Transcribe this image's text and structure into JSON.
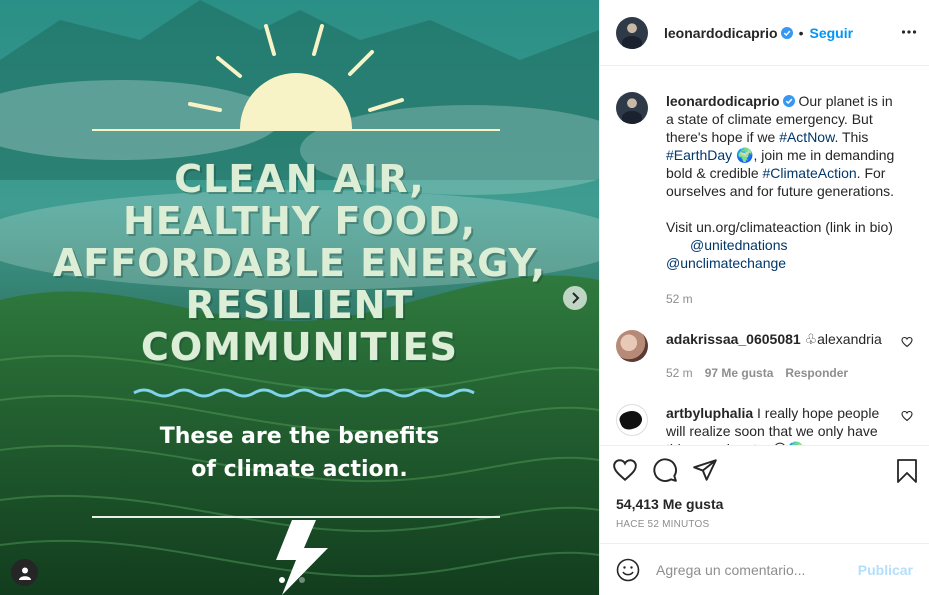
{
  "post": {
    "image": {
      "headline_lines": [
        "CLEAN AIR,",
        "HEALTHY FOOD,",
        "AFFORDABLE ENERGY,",
        "RESILIENT",
        "COMMUNITIES"
      ],
      "sub_lines": [
        "These are the benefits",
        "of climate action."
      ],
      "carousel_total": 3,
      "carousel_active": 1
    },
    "header": {
      "username": "leonardodicaprio",
      "separator": "•",
      "follow_label": "Seguir"
    },
    "caption": {
      "username": "leonardodicaprio",
      "text_1": " Our planet is in a state of climate emergency. But there's hope if we ",
      "tag_actnow": "#ActNow",
      "text_2": ". This ",
      "tag_earthday": "#EarthDay",
      "text_3": " 🌍, join me in demanding bold & credible ",
      "tag_climateaction": "#ClimateAction",
      "text_4": ". For ourselves and for future generations.",
      "text_5": "Visit un.org/climateaction (link in bio)",
      "mention_1": "@unitednations",
      "mention_2": "@unclimatechange",
      "time": "52 m"
    },
    "comments": [
      {
        "username": "adakrissaa_0605081",
        "text": " ♧alexandria",
        "time": "52 m",
        "likes": "97 Me gusta",
        "reply": "Responder"
      },
      {
        "username": "artbyluphalia",
        "text": " I really hope people will realize soon that we only have this one planet... 😥🌍"
      }
    ],
    "likes_count": "54,413 Me gusta",
    "posted": "HACE 52 MINUTOS",
    "add_comment": {
      "placeholder": "Agrega un comentario...",
      "post_label": "Publicar"
    }
  },
  "colors": {
    "link": "#00376b",
    "follow": "#0095f6",
    "post_disabled": "#b2dffc",
    "muted": "#8e8e8e"
  },
  "icons": [
    "chevron-right-icon",
    "user-tag-icon",
    "verified-badge-icon",
    "more-options-icon",
    "heart-icon",
    "comment-icon",
    "share-icon",
    "bookmark-icon",
    "emoji-icon"
  ]
}
